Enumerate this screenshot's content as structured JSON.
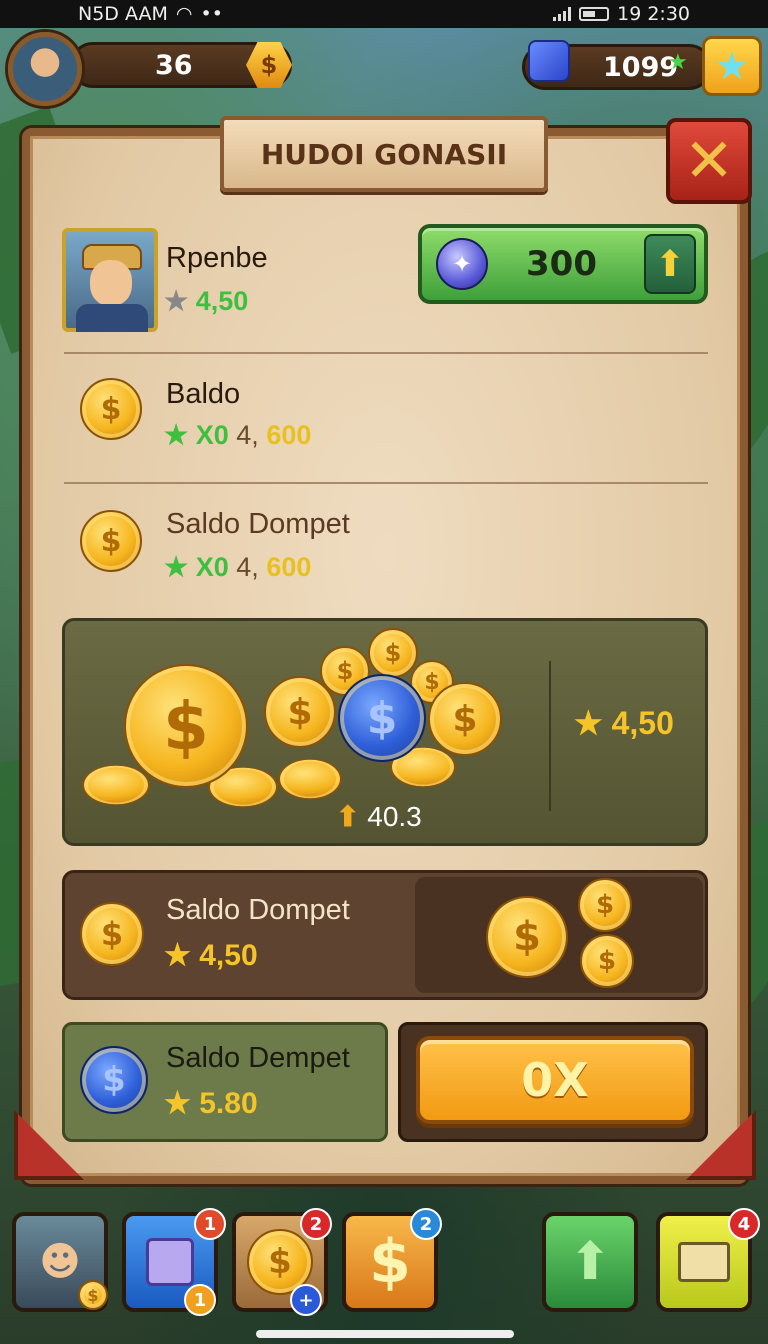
{
  "status_bar": {
    "left_text": "N5D AAM",
    "time": "19 2:30"
  },
  "hud": {
    "coins": "36",
    "coin_icon": "$",
    "gems": "1099"
  },
  "panel": {
    "title": "HUDOI GONASII",
    "close_glyph": "✕"
  },
  "player": {
    "name": "Rpenbe",
    "rating": "4,50",
    "button_value": "300"
  },
  "rows": [
    {
      "name": "Baldo",
      "bonus": "X0",
      "amount_a": "4,",
      "amount_b": "600"
    },
    {
      "name": "Saldo Dompet",
      "bonus": "X0",
      "amount_a": "4,",
      "amount_b": "600"
    }
  ],
  "treasure": {
    "rating": "4,50",
    "increase": "40.3"
  },
  "wallet_card": {
    "name": "Saldo Dompet",
    "rating": "4,50"
  },
  "blue_card": {
    "name": "Saldo Dempet",
    "rating": "5.80"
  },
  "action_button": {
    "label": "0X"
  },
  "glyphs": {
    "star": "★",
    "dollar": "$",
    "up": "⬆",
    "plus": "+"
  },
  "bottom_bar": {
    "slots": [
      {
        "icon": "avatar-icon",
        "badge": ""
      },
      {
        "icon": "cube-icon",
        "badge": "1",
        "badge2": "1"
      },
      {
        "icon": "coin-icon",
        "badge": "2"
      },
      {
        "icon": "dollar-icon",
        "badge": "2"
      },
      {
        "icon": "up-arrow-icon",
        "badge": ""
      },
      {
        "icon": "box-icon",
        "badge": "4"
      }
    ]
  },
  "colors": {
    "gold": "#f5c428",
    "green_star": "#3fbf3f",
    "panel_bg": "#e2c9a4",
    "close_red": "#c02a1e"
  }
}
